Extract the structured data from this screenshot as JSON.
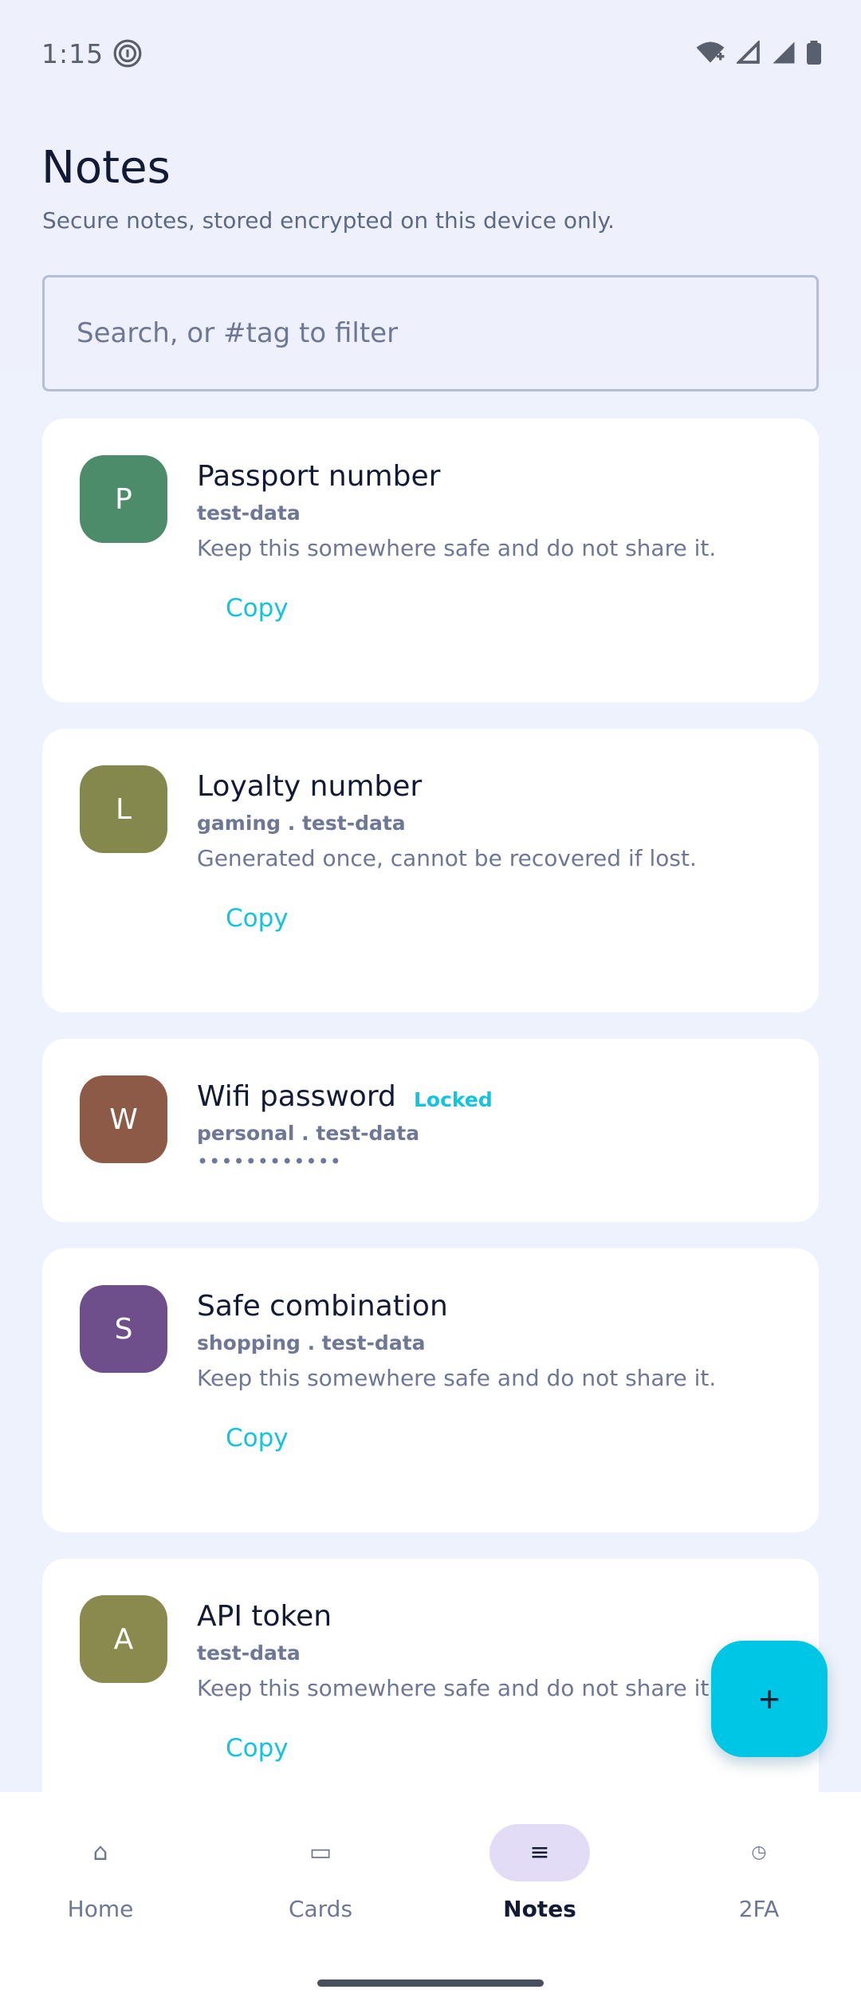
{
  "status_bar": {
    "time": "1:15"
  },
  "header": {
    "title": "Notes",
    "subtitle": "Secure notes, stored encrypted on this device only."
  },
  "search": {
    "placeholder": "Search, or #tag to filter",
    "value": ""
  },
  "notes": [
    {
      "initial": "P",
      "avatar_color": "#4d8c6b",
      "title": "Passport number",
      "tags": "test-data",
      "body": "Keep this somewhere safe and do not share it.",
      "action": "Copy"
    },
    {
      "initial": "L",
      "avatar_color": "#85884d",
      "title": "Loyalty number",
      "tags": "gaming . test-data",
      "body": "Generated once, cannot be recovered if lost.",
      "action": "Copy"
    },
    {
      "initial": "W",
      "avatar_color": "#8d5a47",
      "title": "Wifi password",
      "badge": "Locked",
      "tags": "personal . test-data",
      "masked": "••••••••••••"
    },
    {
      "initial": "S",
      "avatar_color": "#6e4f8b",
      "title": "Safe combination",
      "tags": "shopping . test-data",
      "body": "Keep this somewhere safe and do not share it.",
      "action": "Copy"
    },
    {
      "initial": "A",
      "avatar_color": "#8a8a4e",
      "title": "API token",
      "tags": "test-data",
      "body": "Keep this somewhere safe and do not share it.",
      "action": "Copy"
    }
  ],
  "fab": {
    "label": "+"
  },
  "bottom_nav": [
    {
      "label": "Home",
      "icon": "⌂",
      "icon_name": "home-icon"
    },
    {
      "label": "Cards",
      "icon": "▭",
      "icon_name": "card-icon"
    },
    {
      "label": "Notes",
      "icon": "≡",
      "icon_name": "notes-icon",
      "active": true
    },
    {
      "label": "2FA",
      "icon": "◷",
      "icon_name": "clock-icon"
    }
  ]
}
